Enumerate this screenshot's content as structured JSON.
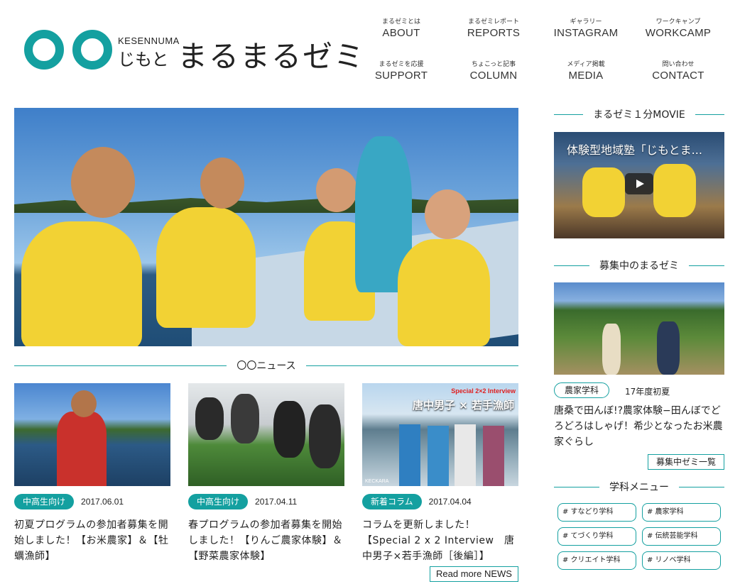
{
  "header": {
    "logo_kesennuma": "KESENNUMA",
    "logo_jimoto": "じもと",
    "logo_title": "まるまるゼミ",
    "nav": [
      {
        "sub": "まるゼミとは",
        "label": "ABOUT"
      },
      {
        "sub": "まるゼミレポート",
        "label": "REPORTS"
      },
      {
        "sub": "ギャラリー",
        "label": "INSTAGRAM"
      },
      {
        "sub": "ワークキャンプ",
        "label": "WORKCAMP"
      },
      {
        "sub": "まるゼミを応援",
        "label": "SUPPORT"
      },
      {
        "sub": "ちょこっと記事",
        "label": "COLUMN"
      },
      {
        "sub": "メディア掲載",
        "label": "MEDIA"
      },
      {
        "sub": "問い合わせ",
        "label": "CONTACT"
      }
    ]
  },
  "news": {
    "heading": "〇〇ニュース",
    "cards": [
      {
        "tag": "中高生向け",
        "date": "2017.06.01",
        "title": "初夏プログラムの参加者募集を開始しました！【お米農家】＆【牡蠣漁師】"
      },
      {
        "tag": "中高生向け",
        "date": "2017.04.11",
        "title": "春プログラムの参加者募集を開始しました！【りんご農家体験】＆【野菜農家体験】"
      },
      {
        "tag": "新着コラム",
        "date": "2017.04.04",
        "title": "コラムを更新しました！【Special 2 x 2 Interview　唐中男子×若手漁師［後編］】"
      }
    ],
    "card3_overlay_small": "Special 2×2 Interview",
    "card3_overlay_big": "唐中男子 × 若手漁師",
    "card3_watermark": "KECKARA",
    "read_more": "Read more NEWS"
  },
  "sidebar": {
    "movie_heading": "まるゼミ１分MOVIE",
    "movie_title": "体験型地域塾「じもとま...",
    "recruit_heading": "募集中のまるゼミ",
    "recruit_tag": "農家学科",
    "recruit_year": "17年度初夏",
    "recruit_title": "唐桑で田んぼ!?農家体験−田んぼでどろどろはしゃげ！希少となったお米農家ぐらし",
    "recruit_list_button": "募集中ゼミ一覧",
    "menu_heading": "学科メニュー",
    "menu_items": [
      "# すなどり学科",
      "# 農家学科",
      "# てづくり学科",
      "# 伝統芸能学科",
      "# クリエイト学科",
      "# リノベ学科"
    ]
  },
  "colors": {
    "accent": "#14a0a0"
  }
}
